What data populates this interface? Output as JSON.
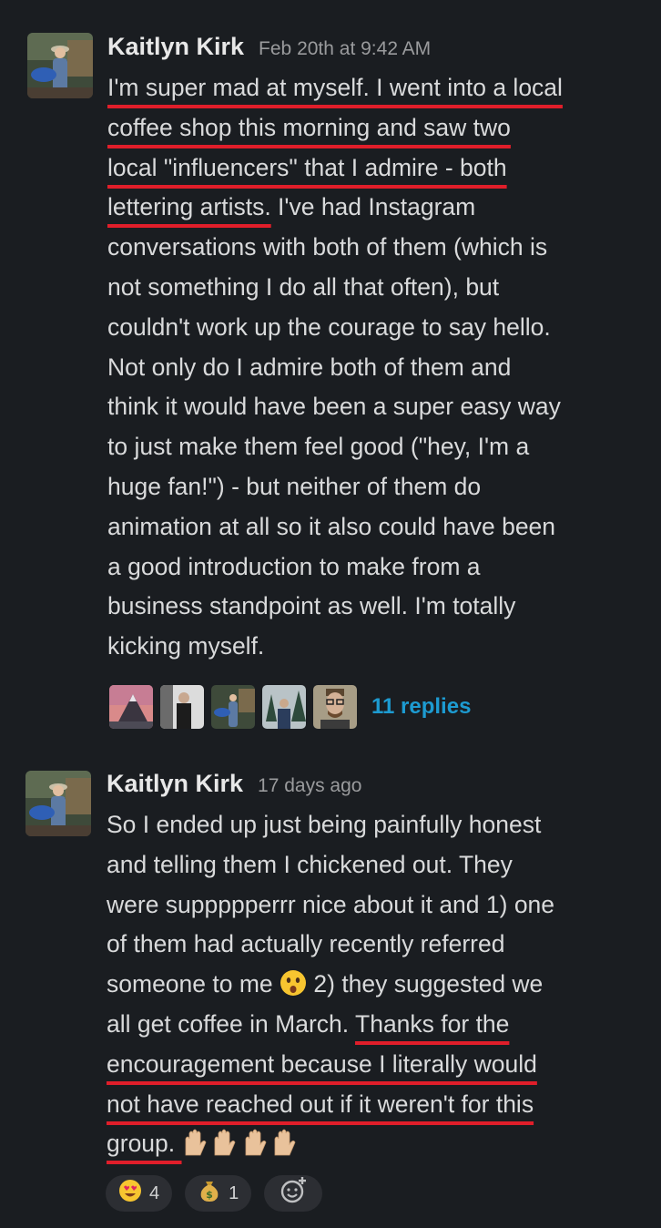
{
  "messages": [
    {
      "author": "Kaitlyn Kirk",
      "timestamp": "Feb 20th at 9:42 AM",
      "text_highlighted": "I'm super mad at myself. I went into a local\ncoffee shop this morning and saw two\nlocal \"influencers\" that I admire - both\nlettering artists.",
      "text_rest": " I've had Instagram\nconversations with both of them (which is\nnot something I do all that often), but\ncouldn't work up the courage to say hello.\nNot only do I admire both of them and\nthink it would have been a super easy way\nto just make them feel good (\"hey, I'm a\nhuge fan!\") - but neither of them do\nanimation at all so it also could have been\na good introduction to make from a\nbusiness standpoint as well. I'm totally\nkicking myself.",
      "thread": {
        "participants": [
          "mountain-avatar",
          "person-dark-avatar",
          "kaitlyn-avatar",
          "forest-avatar",
          "glasses-man-avatar"
        ],
        "replies_label": "11 replies"
      }
    },
    {
      "author": "Kaitlyn Kirk",
      "timestamp": "17 days ago",
      "text_plain_1": "So I ended up just being painfully honest\nand telling them I chickened out. They\nwere suppppperrr nice about it and 1) one\nof them had actually recently referred\nsomeone to me ",
      "inline_emoji_1": "astonished-face",
      "text_plain_2": " 2) they suggested we\nall get coffee in March. ",
      "text_highlighted": "Thanks for the\nencouragement because I literally would\nnot have reached out if it weren't for this\ngroup. ",
      "inline_emoji_2": "raised-hands-x3",
      "reactions": [
        {
          "icon": "heart-eyes-emoji",
          "count": "4"
        },
        {
          "icon": "money-bag-emoji",
          "count": "1"
        }
      ],
      "add_reaction_icon": "add-reaction-icon"
    }
  ],
  "colors": {
    "background": "#1a1d21",
    "link": "#1d9bd1",
    "highlight_underline": "#e01e2a",
    "reaction_pill": "#2c2e33"
  }
}
